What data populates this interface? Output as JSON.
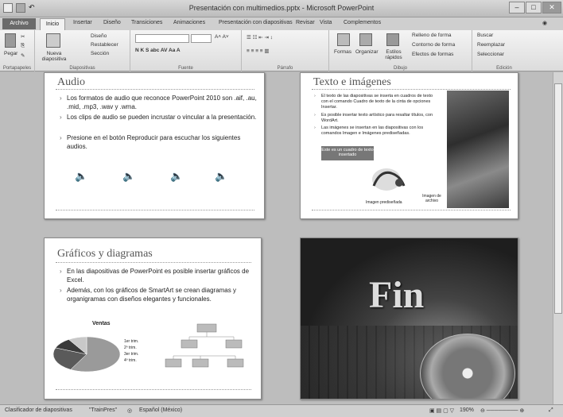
{
  "window": {
    "title": "Presentación con multimedios.pptx - Microsoft PowerPoint"
  },
  "tabs": {
    "file": "Archivo",
    "home": "Inicio",
    "insert": "Insertar",
    "design": "Diseño",
    "transitions": "Transiciones",
    "animations": "Animaciones",
    "slideshow": "Presentación con diapositivas",
    "review": "Revisar",
    "view": "Vista",
    "addins": "Complementos"
  },
  "ribbon": {
    "clipboard": {
      "label": "Portapapeles",
      "paste": "Pegar"
    },
    "slides": {
      "label": "Diapositivas",
      "new": "Nueva diapositiva",
      "layout": "Diseño",
      "reset": "Restablecer",
      "section": "Sección"
    },
    "font": {
      "label": "Fuente"
    },
    "paragraph": {
      "label": "Párrafo"
    },
    "drawing": {
      "label": "Dibujo",
      "shapes": "Formas",
      "arrange": "Organizar",
      "quick": "Estilos rápidos",
      "fill": "Relleno de forma",
      "outline": "Contorno de forma",
      "effects": "Efectos de formas"
    },
    "editing": {
      "label": "Edición",
      "find": "Buscar",
      "replace": "Reemplazar",
      "select": "Seleccionar"
    }
  },
  "slides": {
    "audio": {
      "title": "Audio",
      "bullets": [
        "Los formatos de audio que reconoce PowerPoint 2010 son .aif, .au, .mid, .mp3, .wav y .wma.",
        "Los clips de audio se pueden incrustar o vincular a la presentación.",
        "Presione en el botón Reproducir para escuchar los siguientes audios."
      ]
    },
    "text": {
      "title": "Texto e imágenes",
      "bullets": [
        "El texto de las diapositivas se inserta en cuadros de texto con el comando Cuadro de texto de la cinta de opciones Insertar.",
        "Es posible insertar texto artístico para resaltar títulos, con WordArt.",
        "Las imágenes se insertan en las diapositivas con los comandos Imagen e Imágenes prediseñadas."
      ],
      "box": "Este es un cuadro de texto insertado",
      "cap1": "Imagen prediseñada",
      "cap2": "Imagen de archivo"
    },
    "charts": {
      "title": "Gráficos y diagramas",
      "bullets": [
        "En las diapositivas de PowerPoint es posible insertar gráficos de Excel.",
        "Además, con los gráficos de SmartArt se crean diagramas y organigramas con diseños elegantes y funcionales."
      ],
      "chart_title": "Ventas",
      "legend": [
        "1er trim.",
        "2º trim.",
        "3er trim.",
        "4º trim."
      ]
    },
    "end": {
      "title": "Fin"
    }
  },
  "chart_data": {
    "type": "pie",
    "title": "Ventas",
    "categories": [
      "1er trim.",
      "2º trim.",
      "3er trim.",
      "4º trim."
    ],
    "values": [
      58,
      23,
      10,
      9
    ]
  },
  "status": {
    "view": "Clasificador de diapositivas",
    "theme": "\"TrainPres\"",
    "lang": "Español (México)",
    "zoom": "190%"
  }
}
